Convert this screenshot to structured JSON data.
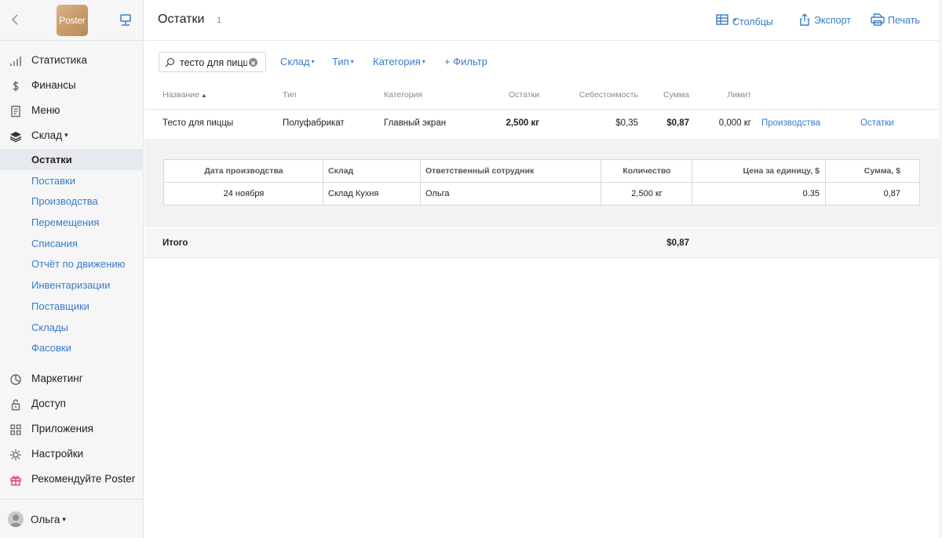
{
  "sidebar": {
    "logo_text": "Poster",
    "nav_top": [
      {
        "label": "Статистика",
        "icon": "bar-chart-icon"
      },
      {
        "label": "Финансы",
        "icon": "dollar-icon"
      },
      {
        "label": "Меню",
        "icon": "document-icon"
      },
      {
        "label": "Склад",
        "icon": "layers-icon",
        "expanded": true
      }
    ],
    "warehouse_items": [
      {
        "label": "Остатки",
        "active": true
      },
      {
        "label": "Поставки"
      },
      {
        "label": "Производства"
      },
      {
        "label": "Перемещения"
      },
      {
        "label": "Списания"
      },
      {
        "label": "Отчёт по движению"
      },
      {
        "label": "Инвентаризации"
      },
      {
        "label": "Поставщики"
      },
      {
        "label": "Склады"
      },
      {
        "label": "Фасовки"
      }
    ],
    "nav_bottom": [
      {
        "label": "Маркетинг",
        "icon": "pie-icon"
      },
      {
        "label": "Доступ",
        "icon": "lock-icon"
      },
      {
        "label": "Приложения",
        "icon": "grid-icon"
      },
      {
        "label": "Настройки",
        "icon": "gear-icon"
      },
      {
        "label": "Рекомендуйте Poster",
        "icon": "gift-icon",
        "icon_color": "#e0465e"
      }
    ],
    "user_name": "Ольга"
  },
  "header": {
    "title": "Остатки",
    "count": "1",
    "columns_label": "Столбцы",
    "export_label": "Экспорт",
    "print_label": "Печать"
  },
  "filters": {
    "search_value": "тесто для пиццы",
    "warehouse_label": "Склад",
    "type_label": "Тип",
    "category_label": "Категория",
    "add_filter_label": "+ Фильтр"
  },
  "table": {
    "headers": {
      "name": "Название",
      "type": "Тип",
      "category": "Категория",
      "balance": "Остатки",
      "cost": "Себестоимость",
      "sum": "Сумма",
      "limit": "Лимит"
    },
    "row": {
      "name": "Тесто для пиццы",
      "type": "Полуфабрикат",
      "category": "Главный экран",
      "balance": "2,500 кг",
      "cost": "$0,35",
      "sum": "$0,87",
      "limit": "0,000 кг",
      "link_production": "Производства",
      "link_balance": "Остатки"
    }
  },
  "details": {
    "headers": {
      "date": "Дата производства",
      "warehouse": "Склад",
      "employee": "Ответственный сотрудник",
      "quantity": "Количество",
      "unit_price": "Цена за единицу, $",
      "sum": "Сумма, $"
    },
    "row": {
      "date": "24 ноября",
      "warehouse": "Склад Кухня",
      "employee": "Ольга",
      "quantity": "2,500 кг",
      "unit_price": "0.35",
      "sum": "0,87"
    }
  },
  "total": {
    "label": "Итого",
    "sum": "$0,87"
  },
  "colors": {
    "accent": "#3a7bc8",
    "gift": "#e0465e"
  }
}
